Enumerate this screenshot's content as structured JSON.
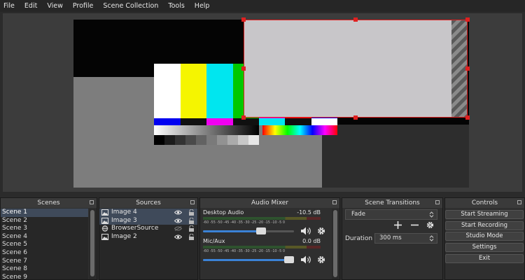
{
  "menu": [
    "File",
    "Edit",
    "View",
    "Profile",
    "Scene Collection",
    "Tools",
    "Help"
  ],
  "docks": {
    "scenes": "Scenes",
    "sources": "Sources",
    "mixer": "Audio Mixer",
    "transitions": "Scene Transitions",
    "controls": "Controls"
  },
  "scenes": [
    "Scene 1",
    "Scene 2",
    "Scene 3",
    "Scene 4",
    "Scene 5",
    "Scene 6",
    "Scene 7",
    "Scene 8",
    "Scene 9"
  ],
  "selected_scene": "Scene 1",
  "sources": [
    {
      "label": "Image 4",
      "icon": "image-icon",
      "visible": true
    },
    {
      "label": "Image 3",
      "icon": "image-icon",
      "visible": true
    },
    {
      "label": "BrowserSource",
      "icon": "globe-icon",
      "visible": false
    },
    {
      "label": "Image 2",
      "icon": "image-icon",
      "visible": true
    }
  ],
  "mixer": {
    "tracks": [
      {
        "name": "Desktop Audio",
        "db": "-10.5 dB",
        "ticks": "-60 -55 -50 -45 -40 -35 -30 -25 -20 -15 -10 -5 0",
        "volume": 0.62,
        "meter": 0.0
      },
      {
        "name": "Mic/Aux",
        "db": "0.0 dB",
        "ticks": "-60 -55 -50 -45 -40 -35 -30 -25 -20 -15 -10 -5 0",
        "volume": 0.95,
        "meter": 0.0
      }
    ]
  },
  "transitions": {
    "type": "Fade",
    "duration_label": "Duration",
    "duration": "300 ms"
  },
  "controls": [
    "Start Streaming",
    "Start Recording",
    "Studio Mode",
    "Settings",
    "Exit"
  ],
  "colors": {
    "selection_border": "#e02020",
    "color_bars": [
      "#ffffff",
      "#f5f500",
      "#00e6ef",
      "#00c800",
      "#f000f0",
      "#f00000",
      "#0000f0"
    ],
    "slider_fill": "#3b82d6"
  }
}
